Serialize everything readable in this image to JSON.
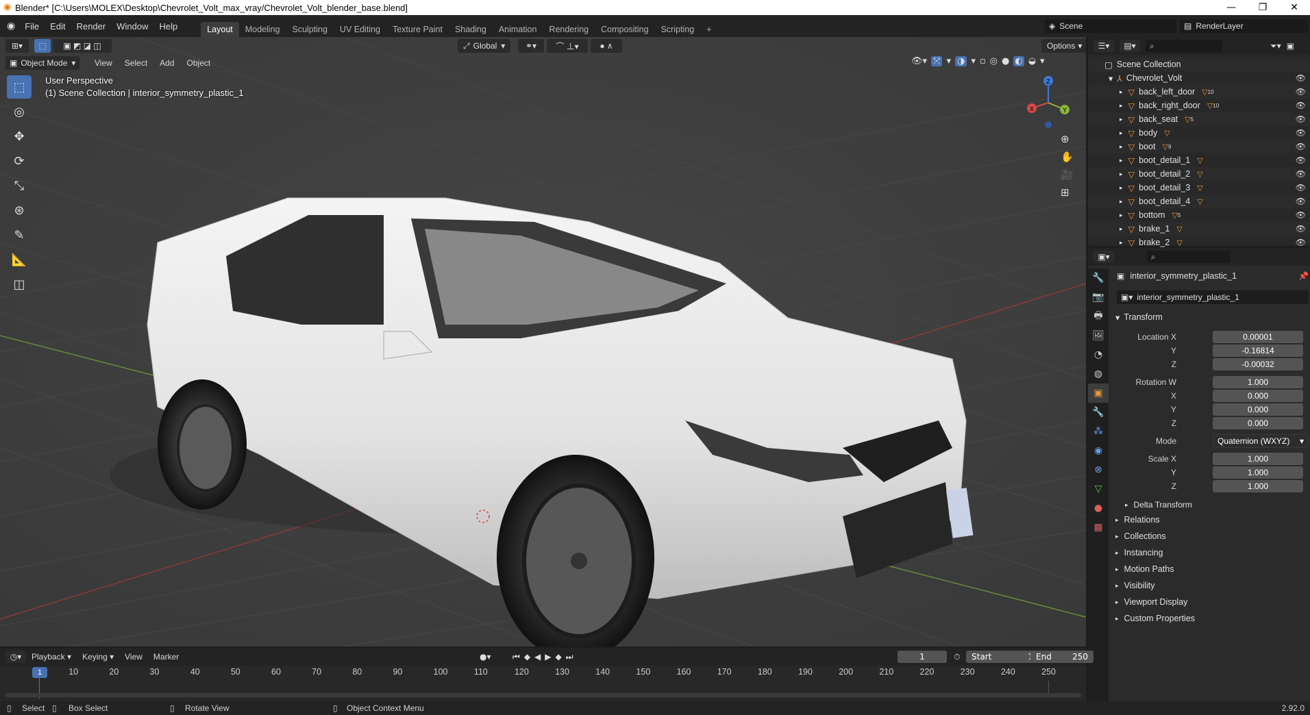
{
  "window": {
    "title": "Blender* [C:\\Users\\MOLEX\\Desktop\\Chevrolet_Volt_max_vray/Chevrolet_Volt_blender_base.blend]",
    "minimize": "—",
    "maximize": "❐",
    "close": "✕"
  },
  "menu": [
    "File",
    "Edit",
    "Render",
    "Window",
    "Help"
  ],
  "workspaces": [
    "Layout",
    "Modeling",
    "Sculpting",
    "UV Editing",
    "Texture Paint",
    "Shading",
    "Animation",
    "Rendering",
    "Compositing",
    "Scripting"
  ],
  "workspace_add": "+",
  "scene": {
    "name": "Scene",
    "render_layer": "RenderLayer"
  },
  "viewport_header": {
    "transform_orientation": "Global",
    "options": "Options",
    "mode": "Object Mode",
    "menus": [
      "View",
      "Select",
      "Add",
      "Object"
    ]
  },
  "viewport_overlay": {
    "perspective": "User Perspective",
    "collection": "(1) Scene Collection | interior_symmetry_plastic_1"
  },
  "gizmo": {
    "x": "X",
    "y": "Y",
    "z": "Z"
  },
  "outliner": {
    "root": "Scene Collection",
    "collection": "Chevrolet_Volt",
    "items": [
      {
        "name": "back_left_door",
        "badge": "10"
      },
      {
        "name": "back_right_door",
        "badge": "10"
      },
      {
        "name": "back_seat",
        "badge": "5"
      },
      {
        "name": "body",
        "badge": ""
      },
      {
        "name": "boot",
        "badge": "9"
      },
      {
        "name": "boot_detail_1",
        "badge": ""
      },
      {
        "name": "boot_detail_2",
        "badge": ""
      },
      {
        "name": "boot_detail_3",
        "badge": ""
      },
      {
        "name": "boot_detail_4",
        "badge": ""
      },
      {
        "name": "bottom",
        "badge": "5"
      },
      {
        "name": "brake_1",
        "badge": ""
      },
      {
        "name": "brake_2",
        "badge": ""
      }
    ]
  },
  "properties": {
    "object_name": "interior_symmetry_plastic_1",
    "object_field": "interior_symmetry_plastic_1",
    "transform_title": "Transform",
    "location": {
      "label_x": "Location X",
      "x": "0.00001",
      "label_y": "Y",
      "y": "-0.16814",
      "label_z": "Z",
      "z": "-0.00032"
    },
    "rotation": {
      "label_w": "Rotation W",
      "w": "1.000",
      "label_x": "X",
      "x": "0.000",
      "label_y": "Y",
      "y": "0.000",
      "label_z": "Z",
      "z": "0.000"
    },
    "mode_label": "Mode",
    "mode_value": "Quaternion (WXYZ)",
    "scale": {
      "label_x": "Scale X",
      "x": "1.000",
      "label_y": "Y",
      "y": "1.000",
      "label_z": "Z",
      "z": "1.000"
    },
    "delta": "Delta Transform",
    "panels": [
      "Relations",
      "Collections",
      "Instancing",
      "Motion Paths",
      "Visibility",
      "Viewport Display",
      "Custom Properties"
    ]
  },
  "timeline": {
    "menus": [
      "Playback",
      "Keying",
      "View",
      "Marker"
    ],
    "current_frame": "1",
    "start_label": "Start",
    "start": "1",
    "end_label": "End",
    "end": "250",
    "ticks": [
      "10",
      "20",
      "30",
      "40",
      "50",
      "60",
      "70",
      "80",
      "90",
      "100",
      "110",
      "120",
      "130",
      "140",
      "150",
      "160",
      "170",
      "180",
      "190",
      "200",
      "210",
      "220",
      "230",
      "240",
      "250"
    ],
    "cursor_frame": "1"
  },
  "statusbar": {
    "select": "Select",
    "box_select": "Box Select",
    "rotate_view": "Rotate View",
    "context_menu": "Object Context Menu",
    "version": "2.92.0"
  },
  "colors": {
    "accent": "#4772b3",
    "active_tab": "#3d3d3d",
    "viewport_bg": "#3c3c3c"
  }
}
